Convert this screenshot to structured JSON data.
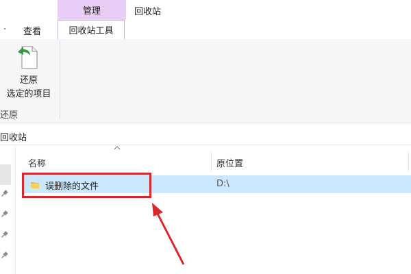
{
  "window": {
    "context_tab": "管理",
    "title": "回收站"
  },
  "ribbon": {
    "tabs": {
      "view": "查看",
      "recycle_tools": "回收站工具"
    },
    "restore_button": {
      "line1": "还原",
      "line2": "选定的项目"
    },
    "group_label": "还原"
  },
  "address": {
    "path": "回收站"
  },
  "columns": {
    "name": "名称",
    "original_location": "原位置"
  },
  "files": [
    {
      "name": "误删除的文件",
      "original_location": "D:\\"
    }
  ],
  "colors": {
    "context_tab_bg": "#e8cdf7",
    "selection_bg": "#cce8ff",
    "annotation_red": "#d9272e"
  },
  "icons": {
    "restore": "restore-file-icon",
    "folder": "folder-icon",
    "pin": "pin-icon",
    "sort": "sort-up-icon"
  }
}
